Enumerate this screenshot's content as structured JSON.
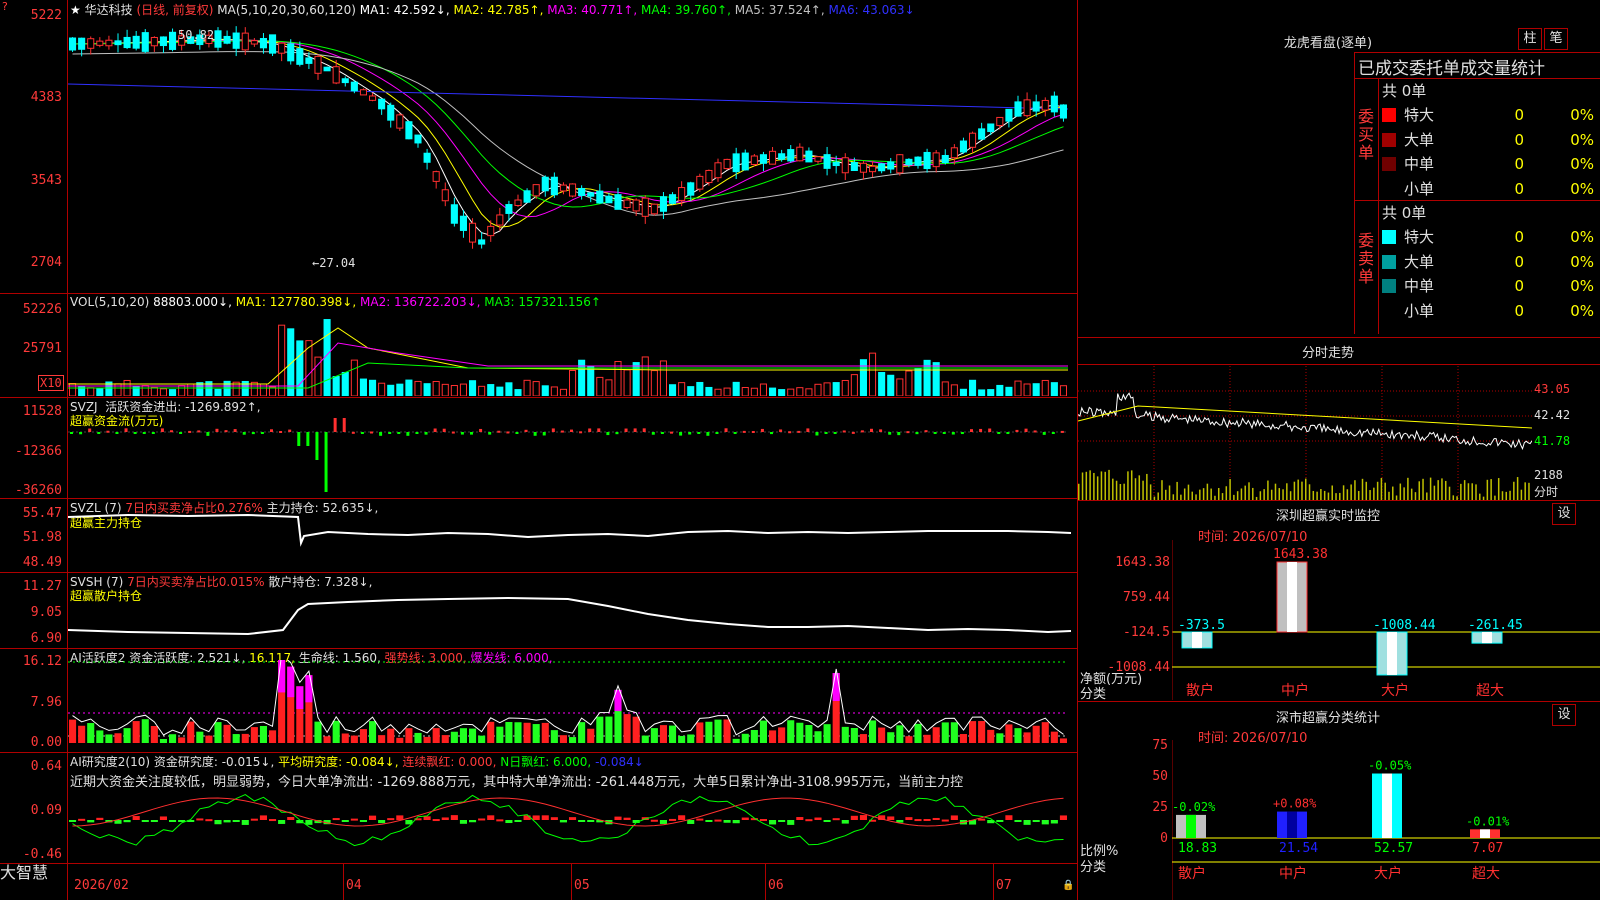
{
  "app": {
    "brand": "大智慧",
    "date_start": "2026/02"
  },
  "main_chart": {
    "title": "华达科技",
    "period": "(日线, 前复权)",
    "ma_label": "MA(5,10,20,30,60,120)",
    "ma1": "MA1: 42.592↓,",
    "ma2": "MA2: 42.785↑,",
    "ma3": "MA3: 40.771↑,",
    "ma4": "MA4: 39.760↑,",
    "ma5": "MA5: 37.524↑,",
    "ma6": "MA6: 43.063↓",
    "y_ticks": [
      "5222",
      "4383",
      "3543",
      "2704"
    ],
    "high_note": "50.82",
    "low_note": "←27.04",
    "colors": {
      "up": "#ff3030",
      "down": "#00ffff",
      "ma1": "#ffffff",
      "ma2": "#ffff00",
      "ma3": "#ff00ff",
      "ma4": "#00ff00",
      "ma5": "#c0c0c0",
      "ma6": "#3030ff"
    }
  },
  "vol_panel": {
    "label": "VOL(5,10,20)",
    "value": "88803.000↓,",
    "ma1": "MA1: 127780.398↓,",
    "ma2": "MA2: 136722.203↓,",
    "ma3": "MA3: 157321.156↑",
    "y_ticks": [
      "52226",
      "25791"
    ],
    "unit": "X10"
  },
  "svzj_panel": {
    "label": "SVZJ",
    "value": "活跃资金进出: -1269.892↑,",
    "sub": "超赢资金流(万元)",
    "y_ticks": [
      "11528",
      "-12366",
      "-36260"
    ]
  },
  "svzl_panel": {
    "label": "SVZL (7)",
    "ratio": "7日内买卖净占比0.276%",
    "value": "主力持仓: 52.635↓,",
    "sub": "超赢主力持仓",
    "y_ticks": [
      "55.47",
      "51.98",
      "48.49"
    ]
  },
  "svsh_panel": {
    "label": "SVSH (7)",
    "ratio": "7日内买卖净占比0.015%",
    "value": "散户持仓: 7.328↓,",
    "sub": "超赢散户持仓",
    "y_ticks": [
      "11.27",
      "9.05",
      "6.90"
    ]
  },
  "ai_active": {
    "label": "AI活跃度2",
    "v1": "资金活跃度: 2.521↓,",
    "v2": "16.117,",
    "v3": "生命线: 1.560,",
    "v4": "强势线: 3.000,",
    "v5": "爆发线: 6.000,",
    "y_ticks": [
      "16.12",
      "7.96",
      "0.00"
    ]
  },
  "ai_research": {
    "label": "AI研究度2(10)",
    "v1": "资金研究度: -0.015↓,",
    "v2": "平均研究度: -0.084↓,",
    "v3": "连续飘红: 0.000,",
    "v4": "N日飘红: 6.000,",
    "v5": "-0.084↓",
    "summary": "近期大资金关注度较低，明显弱势，今日大单净流出: -1269.888万元，其中特大单净流出: -261.448万元，大单5日累计净出-3108.995万元，当前主力控",
    "y_ticks": [
      "0.64",
      "0.09",
      "-0.46"
    ]
  },
  "x_axis": [
    "04",
    "05",
    "06",
    "07"
  ],
  "dragon": {
    "title": "龙虎看盘(逐单)",
    "btn1": "柱",
    "btn2": "笔",
    "header": "已成交委托单成交量统计",
    "buy_label": "委买单",
    "sell_label": "委卖单",
    "buy_total": "共 0单",
    "sell_total": "共 0单",
    "rows_buy": [
      {
        "name": "特大",
        "n": "0",
        "p": "0%",
        "color": "#ff0000"
      },
      {
        "name": "大单",
        "n": "0",
        "p": "0%",
        "color": "#a00000"
      },
      {
        "name": "中单",
        "n": "0",
        "p": "0%",
        "color": "#700000"
      },
      {
        "name": "小单",
        "n": "0",
        "p": "0%",
        "color": ""
      }
    ],
    "rows_sell": [
      {
        "name": "特大",
        "n": "0",
        "p": "0%",
        "color": "#00ffff"
      },
      {
        "name": "大单",
        "n": "0",
        "p": "0%",
        "color": "#00a0a0"
      },
      {
        "name": "中单",
        "n": "0",
        "p": "0%",
        "color": "#008080"
      },
      {
        "name": "小单",
        "n": "0",
        "p": "0%",
        "color": ""
      }
    ]
  },
  "intraday": {
    "title": "分时走势",
    "y_ticks": [
      "43.05",
      "42.42",
      "41.78"
    ],
    "vol_tick": "2188",
    "vol_unit": "分时"
  },
  "sz_monitor": {
    "title": "深圳超赢实时监控",
    "btn": "设",
    "time": "时间: 2026/07/10",
    "y_ticks": [
      "1643.38",
      "759.44",
      "-124.5",
      "-1008.44"
    ],
    "y_unit": "净额(万元)",
    "x_unit": "分类",
    "cats": [
      "散户",
      "中户",
      "大户",
      "超大"
    ],
    "values": [
      -373.5,
      1643.38,
      -1008.44,
      -261.45
    ],
    "labels": [
      "-373.5",
      "1643.38",
      "-1008.44",
      "-261.45"
    ]
  },
  "sz_stats": {
    "title": "深市超赢分类统计",
    "btn": "设",
    "time": "时间: 2026/07/10",
    "y_ticks": [
      "75",
      "50",
      "25",
      "0"
    ],
    "y_unit": "比例%",
    "x_unit": "分类",
    "cats": [
      "散户",
      "中户",
      "大户",
      "超大"
    ],
    "values": [
      18.83,
      21.54,
      52.57,
      7.07
    ],
    "value_labels": [
      "18.83",
      "21.54",
      "52.57",
      "7.07"
    ],
    "changes": [
      "-0.02%",
      "+0.08%",
      "-0.05%",
      "-0.01%"
    ]
  }
}
